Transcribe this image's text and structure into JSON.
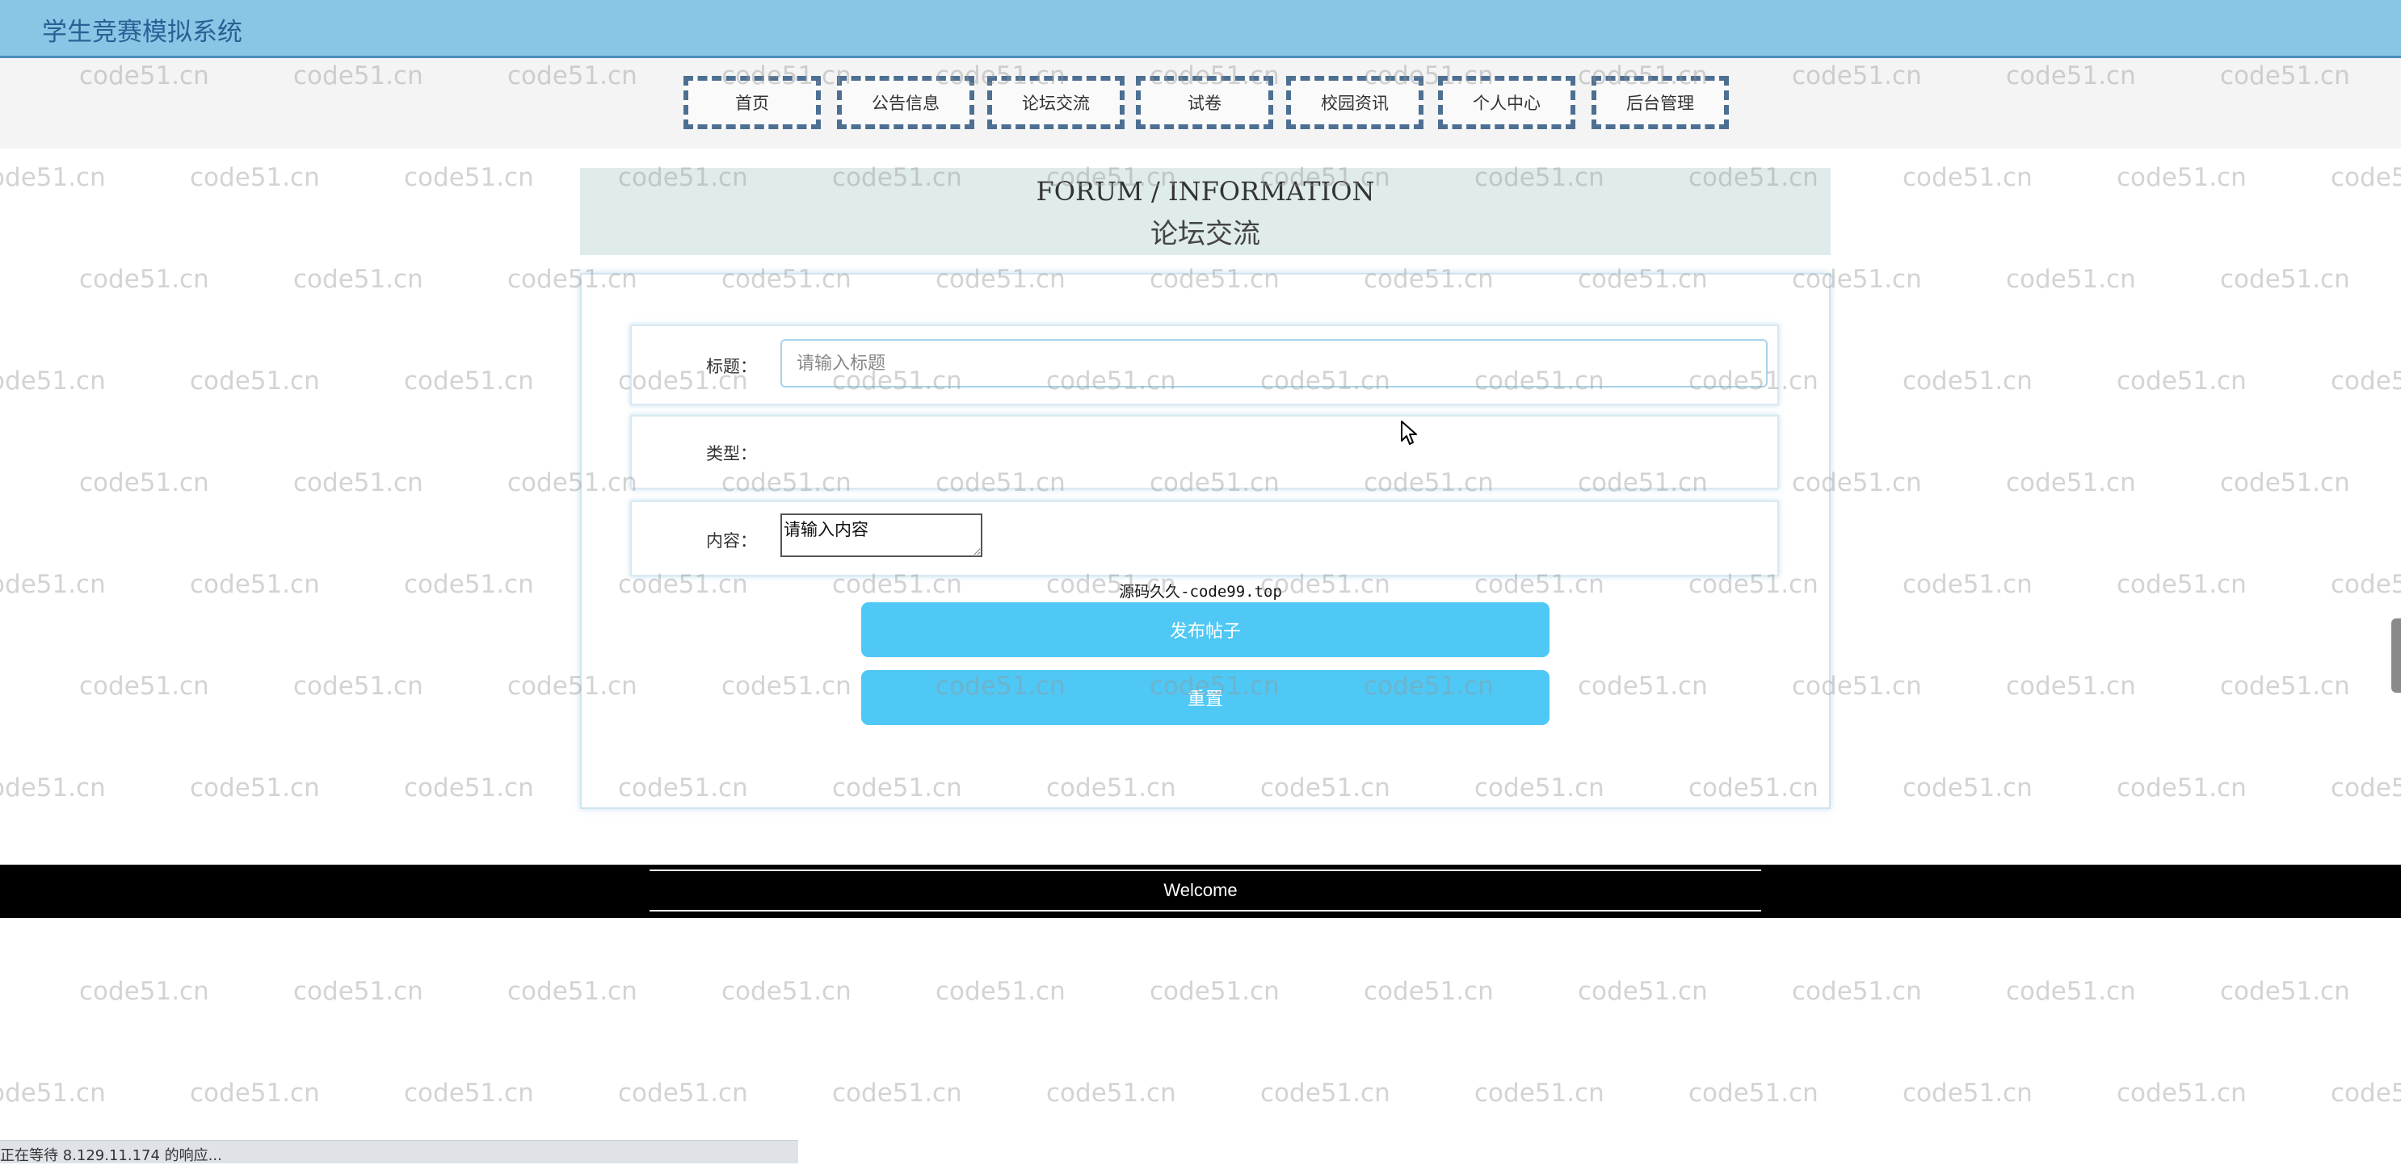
{
  "header": {
    "title": "学生竞赛模拟系统"
  },
  "nav": {
    "items": [
      {
        "label": "首页"
      },
      {
        "label": "公告信息"
      },
      {
        "label": "论坛交流"
      },
      {
        "label": "试卷"
      },
      {
        "label": "校园资讯"
      },
      {
        "label": "个人中心"
      },
      {
        "label": "后台管理"
      }
    ]
  },
  "banner": {
    "title_en": "FORUM / INFORMATION",
    "title_cn": "论坛交流"
  },
  "form": {
    "title_label": "标题：",
    "title_placeholder": "请输入标题",
    "type_label": "类型：",
    "content_label": "内容：",
    "content_placeholder": "请输入内容",
    "source_note": "源码久久-code99.top",
    "submit_label": "发布帖子",
    "reset_label": "重置"
  },
  "footer": {
    "text": "Welcome"
  },
  "watermark": {
    "text": "code51.cn"
  },
  "status": {
    "text": "正在等待 8.129.11.174 的响应..."
  },
  "colors": {
    "header_bg": "#89c6e6",
    "nav_border": "#4d6f92",
    "banner_bg": "#e0ebeb",
    "button_bg": "#4fc8f5",
    "footer_bg": "#000000"
  },
  "icons": {
    "cursor": "arrow-cursor-icon"
  }
}
